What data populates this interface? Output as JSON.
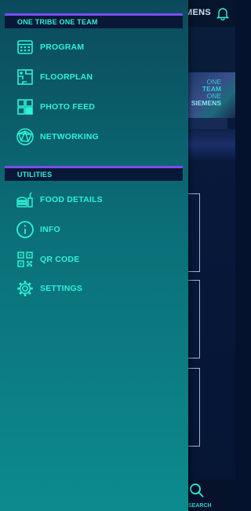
{
  "background_app": {
    "header_title_fragment": "MENS",
    "banner": {
      "line1": "ONE",
      "line2": "TEAM",
      "line3": "ONE",
      "line4": "SIEMENS"
    },
    "bottom_nav": {
      "search_label": "SEARCH"
    }
  },
  "drawer": {
    "sections": [
      {
        "title": "ONE TRIBE ONE TEAM",
        "items": [
          {
            "label": "PROGRAM",
            "icon": "calendar-icon"
          },
          {
            "label": "FLOORPLAN",
            "icon": "floorplan-icon"
          },
          {
            "label": "PHOTO FEED",
            "icon": "grid-icon"
          },
          {
            "label": "NETWORKING",
            "icon": "network-globe-icon"
          }
        ]
      },
      {
        "title": "UTILITIES",
        "items": [
          {
            "label": "FOOD DETAILS",
            "icon": "food-icon"
          },
          {
            "label": "INFO",
            "icon": "info-icon"
          },
          {
            "label": "QR CODE",
            "icon": "qr-code-icon"
          },
          {
            "label": "SETTINGS",
            "icon": "gear-icon"
          }
        ]
      }
    ]
  },
  "colors": {
    "accent": "#2ef2d8",
    "section_bar": "#7b4df0",
    "section_bg": "#0a1838",
    "drawer_top": "#0b4a5c",
    "drawer_bottom": "#0c8b8d"
  }
}
